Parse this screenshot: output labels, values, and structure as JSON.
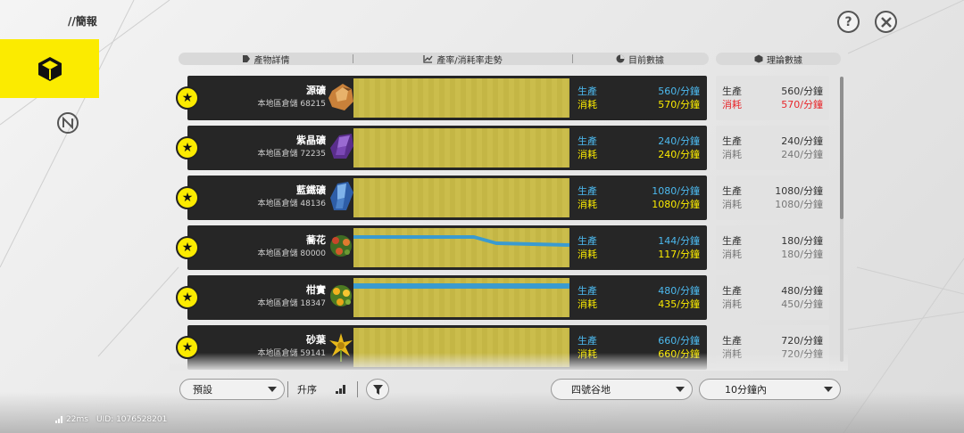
{
  "header": {
    "title": "//簡報",
    "help_label": "?",
    "close_icon": "close-x-icon"
  },
  "columns": {
    "details": "產物詳情",
    "trend": "產率/消耗率走勢",
    "current": "目前數據",
    "theory": "理論數據"
  },
  "labels": {
    "produce": "生產",
    "consume": "消耗"
  },
  "items": [
    {
      "name": "源礦",
      "stock": "本地區倉儲 68215",
      "icon": "orange-ore-icon",
      "prod": "560/分鐘",
      "cons": "570/分鐘",
      "theory_prod": "560/分鐘",
      "theory_cons": "570/分鐘",
      "theory_warn": true,
      "trend": "flat"
    },
    {
      "name": "紫晶礦",
      "stock": "本地區倉儲 72235",
      "icon": "amethyst-ore-icon",
      "prod": "240/分鐘",
      "cons": "240/分鐘",
      "theory_prod": "240/分鐘",
      "theory_cons": "240/分鐘",
      "theory_warn": false,
      "trend": "flat"
    },
    {
      "name": "藍鐵礦",
      "stock": "本地區倉儲 48136",
      "icon": "blue-iron-ore-icon",
      "prod": "1080/分鐘",
      "cons": "1080/分鐘",
      "theory_prod": "1080/分鐘",
      "theory_cons": "1080/分鐘",
      "theory_warn": false,
      "trend": "flat"
    },
    {
      "name": "蕎花",
      "stock": "本地區倉儲 80000",
      "icon": "buckflower-plant-icon",
      "prod": "144/分鐘",
      "cons": "117/分鐘",
      "theory_prod": "180/分鐘",
      "theory_cons": "180/分鐘",
      "theory_warn": false,
      "trend": "decline"
    },
    {
      "name": "柑實",
      "stock": "本地區倉儲 18347",
      "icon": "citrus-plant-icon",
      "prod": "480/分鐘",
      "cons": "435/分鐘",
      "theory_prod": "480/分鐘",
      "theory_cons": "450/分鐘",
      "theory_warn": false,
      "trend": "surplus"
    },
    {
      "name": "砂葉",
      "stock": "本地區倉儲 59141",
      "icon": "sandleaf-plant-icon",
      "prod": "660/分鐘",
      "cons": "660/分鐘",
      "theory_prod": "720/分鐘",
      "theory_cons": "720/分鐘",
      "theory_warn": false,
      "trend": "flat"
    }
  ],
  "controls": {
    "preset": "預設",
    "sort": "升序",
    "region": "四號谷地",
    "time_range": "10分鐘內"
  },
  "status": {
    "ping": "22ms",
    "uid": "UID: 1076528201"
  },
  "colors": {
    "accent": "#fbeb00",
    "production": "#4cb9ef",
    "warning": "#e8262b"
  }
}
